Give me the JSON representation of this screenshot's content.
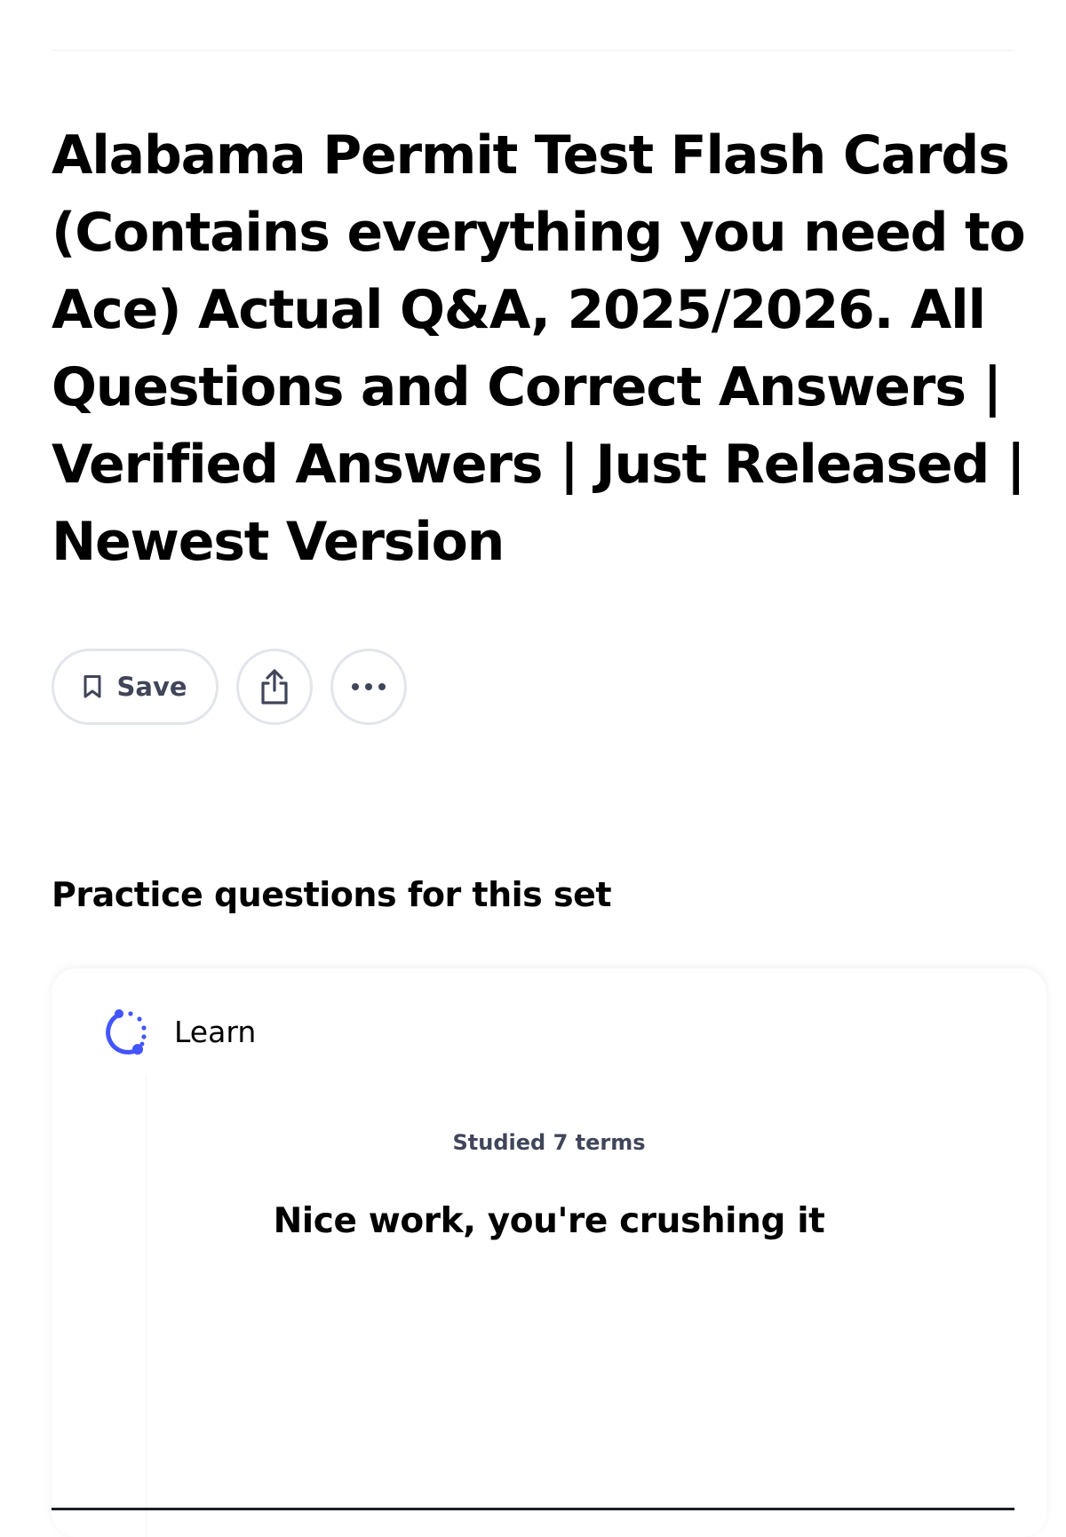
{
  "page": {
    "title": "Alabama Permit Test Flash Cards (Contains everything you need to Ace) Actual Q&A, 2025/2026. All Questions and Correct Answers | Verified Answers | Just Released | Newest Version"
  },
  "actions": {
    "save_label": "Save",
    "save_icon": "bookmark-icon",
    "share_icon": "share-icon",
    "more_icon": "more-options-icon"
  },
  "practice": {
    "section_title": "Practice questions for this set",
    "mode": {
      "label": "Learn",
      "icon": "learn-progress-icon"
    },
    "studied_text": "Studied 7 terms",
    "message": "Nice work, you're crushing it"
  },
  "colors": {
    "accent": "#4255ff",
    "text_primary": "#000000",
    "text_secondary": "#40455a",
    "border": "#e3e5ec"
  }
}
